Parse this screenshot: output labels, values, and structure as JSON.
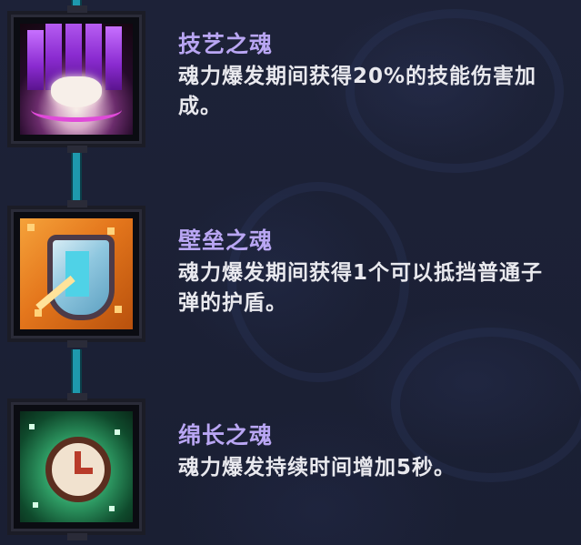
{
  "skills": [
    {
      "name": "技艺之魂",
      "description": "魂力爆发期间获得20%的技能伤害加成。",
      "icon": "purple-flame-soul-icon",
      "accent": "#c770ff"
    },
    {
      "name": "壁垒之魂",
      "description": "魂力爆发期间获得1个可以抵挡普通子弹的护盾。",
      "icon": "shield-soul-icon",
      "accent": "#f0972d"
    },
    {
      "name": "绵长之魂",
      "description": "魂力爆发持续时间增加5秒。",
      "icon": "clock-soul-icon",
      "accent": "#2e9a63"
    }
  ],
  "colors": {
    "title": "#b9a6f3",
    "description": "#e9e9ee",
    "connector": "#1e99ad",
    "background": "#1c2136"
  }
}
